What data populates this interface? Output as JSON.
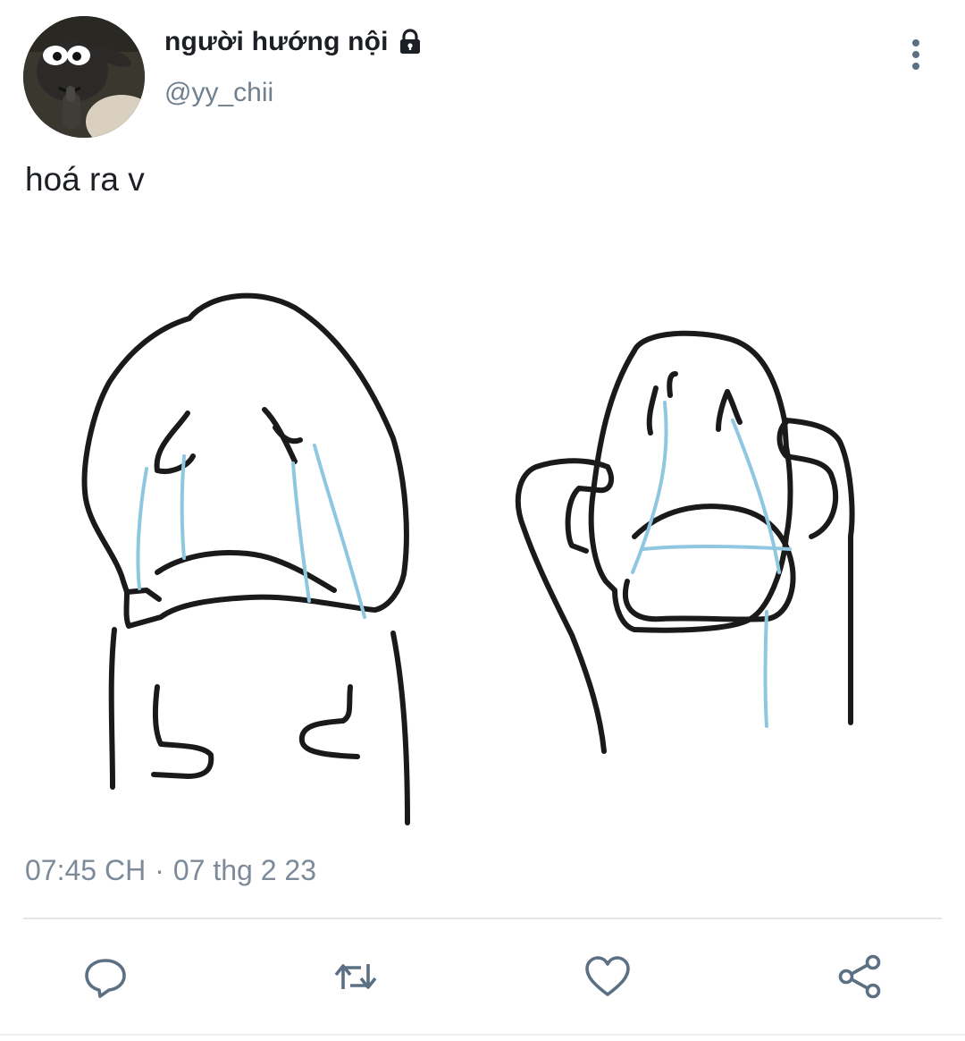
{
  "tweet": {
    "display_name": "người hướng nội",
    "handle": "@yy_chii",
    "text": "hoá ra v",
    "time": "07:45 CH",
    "separator": "·",
    "date": "07 thg 2 23",
    "account_locked": true
  },
  "icons": {
    "lock": "lock-icon",
    "more": "more-vertical-icon",
    "reply": "reply-icon",
    "retweet": "retweet-icon",
    "like": "heart-icon",
    "share": "share-icon"
  },
  "colors": {
    "text_primary": "#1c1f23",
    "text_secondary": "#6f7f8e",
    "icon": "#5b7083",
    "tear_blue": "#8fc7e0"
  }
}
